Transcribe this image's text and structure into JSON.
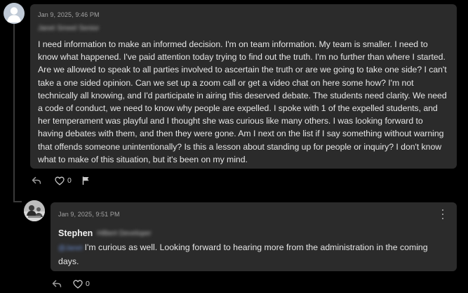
{
  "main_post": {
    "timestamp": "Jan 9, 2025, 9:46 PM",
    "author_redacted": "Janet Smeel Senior",
    "body": "I need information to make an informed decision. I'm on team information. My team is smaller. I need to know what happened. I've paid attention today trying to find out the truth. I'm no further than where I started. Are we allowed to speak to all parties involved to ascertain the truth or are we going to take one side? I can't take a one sided opinion. Can we set up a zoom call or get a video chat on here some how? I'm not technically all knowing, and I'd participate in airing this deserved debate. The students need clarity. We need a code of conduct, we need to know why people are expelled. I spoke with 1 of the expelled students, and her temperament was playful and I thought she was curious like many others. I was looking forward to having debates with them, and then they were gone. Am I next on the list if I say something without warning that offends someone unintentionally? Is this a lesson about standing up for people or inquiry? I don't know what to make of this situation, but it's been on my mind.",
    "like_count": "0",
    "icons": {
      "avatar": "default-user-avatar-icon",
      "reply": "reply-arrow-icon",
      "like": "heart-outline-icon",
      "flag": "flag-icon"
    }
  },
  "reply_post": {
    "timestamp": "Jan 9, 2025, 9:51 PM",
    "author_name": "Stephen",
    "author_redacted": "Hilbert Developer",
    "mention_redacted": "@Janet",
    "body": "I'm curious as well. Looking forward to hearing more from the administration in the coming days.",
    "like_count": "0",
    "icons": {
      "avatar": "user-photo-avatar",
      "menu": "kebab-menu-icon",
      "reply": "reply-arrow-icon",
      "like": "heart-outline-icon"
    }
  },
  "colors": {
    "background": "#000000",
    "card": "#2b2b2b",
    "text": "#e6e6e6",
    "muted": "#a3a3a3",
    "mention": "#6d8fd6",
    "thread_line": "#3a3a3a"
  }
}
